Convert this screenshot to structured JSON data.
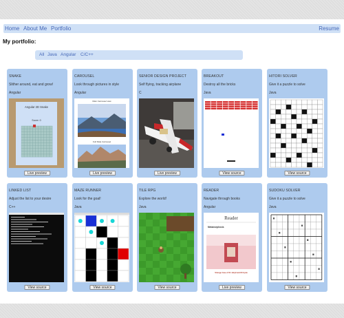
{
  "nav": {
    "home": "Home",
    "about": "About Me",
    "portfolio": "Portfolio",
    "resume": "Resume"
  },
  "heading": "My portfolio:",
  "filters": [
    "All",
    "Java",
    "Angular",
    "C/C++"
  ],
  "projects": [
    {
      "title": "SNAKE",
      "description": "Slither around, eat and grow!",
      "language": "Angular",
      "button": "Live preview",
      "thumb_text": {
        "title": "Angular 2D Snake",
        "score": "Score: 0"
      }
    },
    {
      "title": "CAROUSEL",
      "description": "Look through pictures in style",
      "language": "Angular",
      "button": "Live preview",
      "thumb_text": {
        "top": "Main Carrousel view",
        "middle": "Full Slide Carrousel"
      }
    },
    {
      "title": "SENIOR DESIGN PROJECT",
      "description": "Self flying, tracking airplane",
      "language": "C",
      "button": "Live preview"
    },
    {
      "title": "BREAKOUT",
      "description": "Destroy all the bricks",
      "language": "Java",
      "button": "View source"
    },
    {
      "title": "HITORI SOLVER",
      "description": "Give it a puzzle to solve",
      "language": "Java",
      "button": "View source"
    },
    {
      "title": "LINKED LIST",
      "description": "Adjust the list to your desire",
      "language": "C++",
      "button": "View source"
    },
    {
      "title": "MAZE RUNNER",
      "description": "Look for the goal!",
      "language": "Java",
      "button": "View source"
    },
    {
      "title": "TILE RPG",
      "description": "Explore the world!",
      "language": "Java",
      "button": "View source"
    },
    {
      "title": "READER",
      "description": "Navigate through books",
      "language": "Angular",
      "button": "Live preview",
      "thumb_text": {
        "title": "Reader",
        "subtitle": "Metamorphosis",
        "book": "Strange Case of Dr Jekyll and Mr Hyde"
      }
    },
    {
      "title": "SUDOKU SOLVER",
      "description": "Give it a puzzle to solve",
      "language": "Java",
      "button": "View source"
    }
  ]
}
